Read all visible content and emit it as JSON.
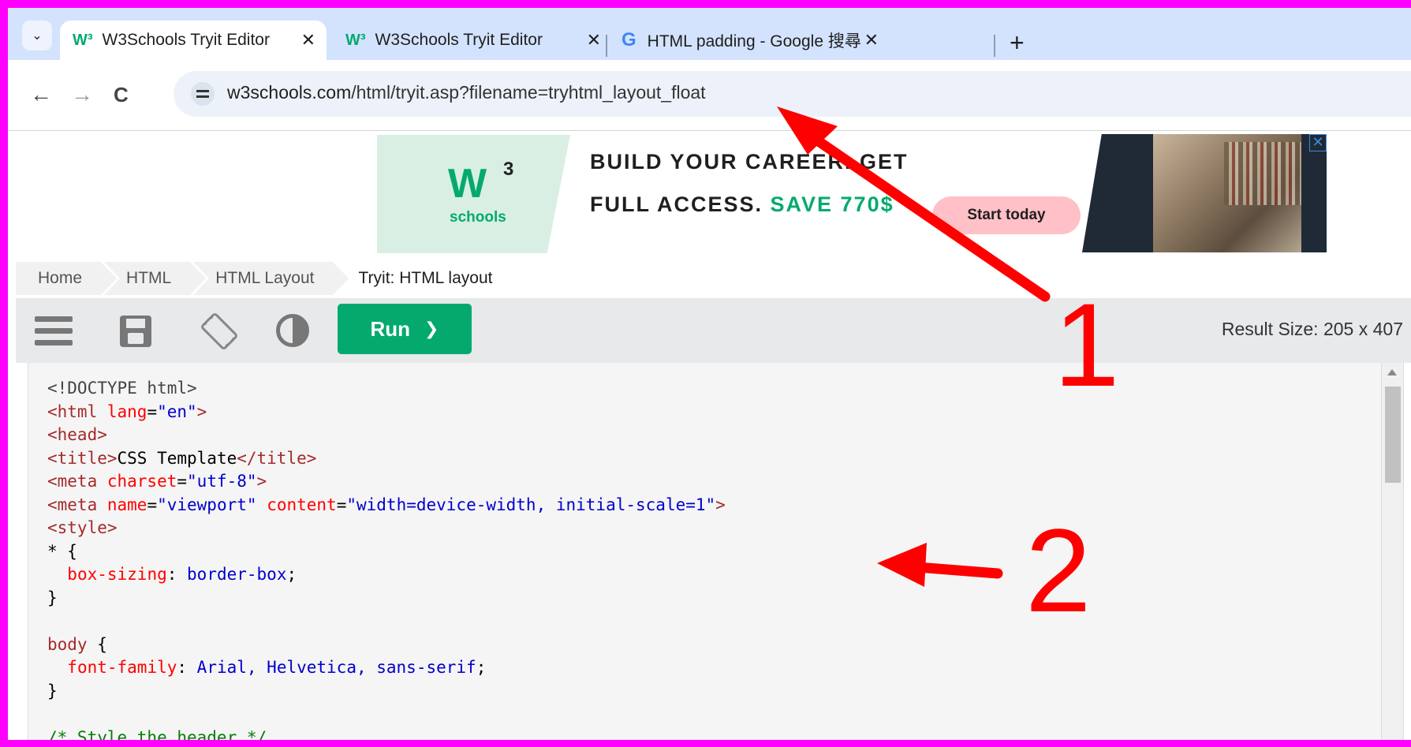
{
  "browser": {
    "tabs": [
      {
        "title": "W3Schools Tryit Editor",
        "favicon": "w3schools-icon",
        "active": true
      },
      {
        "title": "W3Schools Tryit Editor",
        "favicon": "w3schools-icon",
        "active": false
      },
      {
        "title": "HTML padding - Google 搜尋",
        "favicon": "google-icon",
        "active": false
      }
    ],
    "tab_menu_glyph": "⌄",
    "close_glyph": "✕",
    "newtab_glyph": "+",
    "nav": {
      "back": "←",
      "forward": "→",
      "reload": "C"
    },
    "url": {
      "host": "w3schools.com",
      "path": "/html/tryit.asp?filename=tryhtml_layout_float"
    }
  },
  "ad": {
    "logo_mark": "W",
    "logo_sup": "3",
    "logo_text": "schools",
    "line1": "BUILD YOUR CAREER. GET",
    "line2_prefix": "FULL ACCESS. ",
    "line2_highlight": "SAVE 770$",
    "cta": "Start today",
    "close": "✕"
  },
  "breadcrumb": [
    "Home",
    "HTML",
    "HTML Layout",
    "Tryit: HTML layout"
  ],
  "editor": {
    "run_label": "Run",
    "run_chevron": "❯",
    "result_size": "Result Size: 205 x 407"
  },
  "code_lines": [
    [
      [
        "dt",
        "<!DOCTYPE html>"
      ]
    ],
    [
      [
        "tag",
        "<html "
      ],
      [
        "attr",
        "lang"
      ],
      [
        "",
        "="
      ],
      [
        "val",
        "\"en\""
      ],
      [
        "tag",
        ">"
      ]
    ],
    [
      [
        "tag",
        "<head>"
      ]
    ],
    [
      [
        "tag",
        "<title>"
      ],
      [
        "",
        "CSS Template"
      ],
      [
        "tag",
        "</title>"
      ]
    ],
    [
      [
        "tag",
        "<meta "
      ],
      [
        "attr",
        "charset"
      ],
      [
        "",
        "="
      ],
      [
        "val",
        "\"utf-8\""
      ],
      [
        "tag",
        ">"
      ]
    ],
    [
      [
        "tag",
        "<meta "
      ],
      [
        "attr",
        "name"
      ],
      [
        "",
        "="
      ],
      [
        "val",
        "\"viewport\""
      ],
      [
        "",
        " "
      ],
      [
        "attr",
        "content"
      ],
      [
        "",
        "="
      ],
      [
        "val",
        "\"width=device-width, initial-scale=1\""
      ],
      [
        "tag",
        ">"
      ]
    ],
    [
      [
        "tag",
        "<style>"
      ]
    ],
    [
      [
        "",
        "* {"
      ]
    ],
    [
      [
        "",
        "  "
      ],
      [
        "attr",
        "box-sizing"
      ],
      [
        "",
        ": "
      ],
      [
        "val",
        "border-box"
      ],
      [
        "",
        ";"
      ]
    ],
    [
      [
        "",
        "}"
      ]
    ],
    [
      [
        "",
        ""
      ]
    ],
    [
      [
        "tag",
        "body"
      ],
      [
        "",
        " {"
      ]
    ],
    [
      [
        "",
        "  "
      ],
      [
        "attr",
        "font-family"
      ],
      [
        "",
        ": "
      ],
      [
        "val",
        "Arial, Helvetica, sans-serif"
      ],
      [
        "",
        ";"
      ]
    ],
    [
      [
        "",
        "}"
      ]
    ],
    [
      [
        "",
        ""
      ]
    ],
    [
      [
        "cmt",
        "/* Style the header */"
      ]
    ]
  ],
  "annotations": {
    "label1": "1",
    "label2": "2",
    "color": "#ff0000",
    "border_color": "#ff00ff"
  }
}
